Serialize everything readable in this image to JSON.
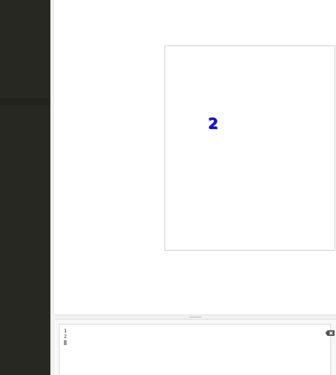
{
  "canvas": {
    "glyph_primary": "2",
    "glyph_secondary": "2"
  },
  "console": {
    "lines": [
      "1",
      "2"
    ],
    "clear_icon": "backspace-icon"
  },
  "colors": {
    "sidebar": "#272822",
    "glyph": "#2020c8"
  }
}
